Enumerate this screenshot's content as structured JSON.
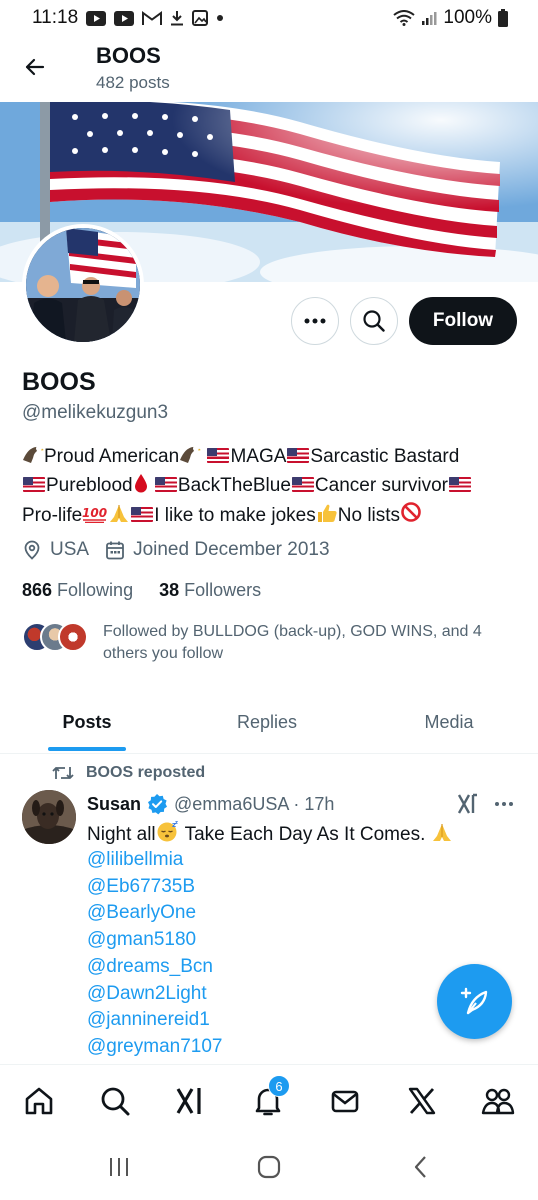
{
  "status_bar": {
    "time": "11:18",
    "battery": "100%"
  },
  "header": {
    "title": "BOOS",
    "post_count": "482 posts"
  },
  "profile": {
    "display_name": "BOOS",
    "handle": "@melikekuzgun3",
    "follow_label": "Follow",
    "bio": {
      "seg1": "Proud American",
      "seg2": "MAGA",
      "seg3": "Sarcastic Bastard",
      "seg4": "Pureblood",
      "seg5": "BackTheBlue",
      "seg6": "Cancer survivor",
      "seg7": "Pro-life",
      "seg8": "I like to make jokes",
      "seg9": "No lists"
    },
    "location": "USA",
    "joined": "Joined December 2013",
    "following_count": "866",
    "following_label": "Following",
    "followers_count": "38",
    "followers_label": "Followers",
    "followed_by": "Followed by BULLDOG (back-up), GOD WINS, and 4 others you follow"
  },
  "tabs": [
    {
      "label": "Posts",
      "active": true
    },
    {
      "label": "Replies",
      "active": false
    },
    {
      "label": "Media",
      "active": false
    }
  ],
  "post": {
    "repost_label": "BOOS reposted",
    "author_name": "Susan",
    "author_handle": "@emma6USA · 17h",
    "text_before": "Night all",
    "text_after": " Take Each Day As It Comes. ",
    "mentions": [
      "@lilibellmia",
      "@Eb67735B",
      "@BearlyOne",
      "@gman5180",
      "@dreams_Bcn",
      "@Dawn2Light",
      "@janninereid1",
      "@greyman7107"
    ]
  },
  "bottom_nav": {
    "items": [
      "home-icon",
      "search-icon",
      "grok-icon",
      "notifications-icon",
      "messages-icon",
      "x-logo-icon",
      "communities-icon"
    ],
    "notification_count": "6"
  },
  "colors": {
    "accent": "#1d9bf0",
    "text": "#0f1419",
    "secondary": "#536471",
    "button_dark": "#0f1419"
  }
}
